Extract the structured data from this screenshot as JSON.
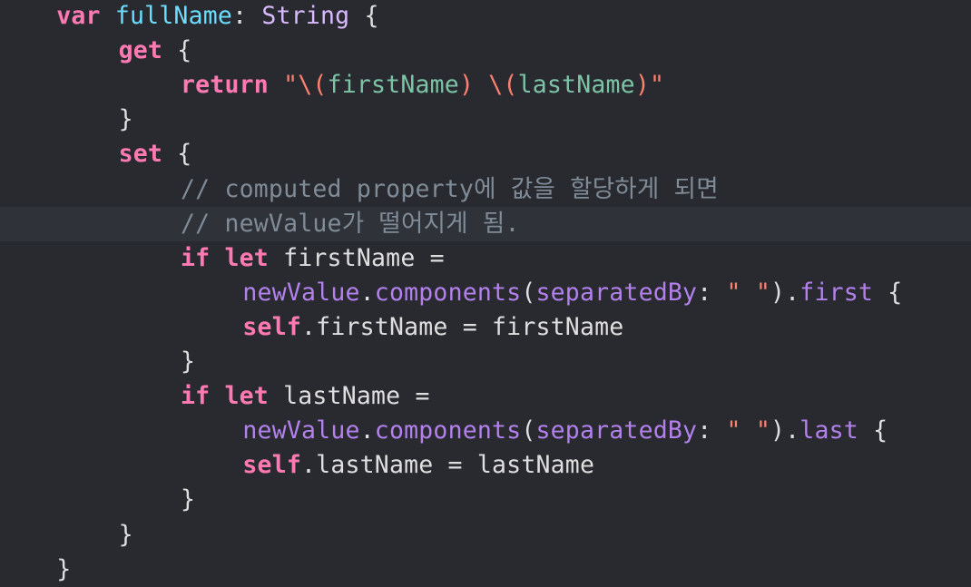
{
  "editor": {
    "current_line_index": 6,
    "lines": [
      {
        "indent": 2,
        "tokens": [
          {
            "t": "var",
            "c": "kw"
          },
          {
            "t": " ",
            "c": "plain"
          },
          {
            "t": "fullName",
            "c": "decl"
          },
          {
            "t": ": ",
            "c": "plain"
          },
          {
            "t": "String",
            "c": "type"
          },
          {
            "t": " {",
            "c": "plain"
          }
        ]
      },
      {
        "indent": 6,
        "tokens": [
          {
            "t": "get",
            "c": "kw"
          },
          {
            "t": " {",
            "c": "plain"
          }
        ]
      },
      {
        "indent": 10,
        "tokens": [
          {
            "t": "return",
            "c": "kw"
          },
          {
            "t": " ",
            "c": "plain"
          },
          {
            "t": "\"\\(",
            "c": "str"
          },
          {
            "t": "firstName",
            "c": "prop"
          },
          {
            "t": ") \\(",
            "c": "str"
          },
          {
            "t": "lastName",
            "c": "prop"
          },
          {
            "t": ")\"",
            "c": "str"
          }
        ]
      },
      {
        "indent": 6,
        "tokens": [
          {
            "t": "}",
            "c": "plain"
          }
        ]
      },
      {
        "indent": 6,
        "tokens": [
          {
            "t": "set",
            "c": "kw"
          },
          {
            "t": " {",
            "c": "plain"
          }
        ]
      },
      {
        "indent": 10,
        "tokens": [
          {
            "t": "// computed property에 값을 할당하게 되면",
            "c": "cmt"
          }
        ]
      },
      {
        "indent": 10,
        "tokens": [
          {
            "t": "// newValue가 떨어지게 됨.",
            "c": "cmt"
          }
        ]
      },
      {
        "indent": 10,
        "tokens": [
          {
            "t": "if",
            "c": "kw"
          },
          {
            "t": " ",
            "c": "plain"
          },
          {
            "t": "let",
            "c": "kw"
          },
          {
            "t": " firstName =",
            "c": "plain"
          }
        ]
      },
      {
        "indent": 14,
        "tokens": [
          {
            "t": "newValue",
            "c": "meth"
          },
          {
            "t": ".",
            "c": "plain"
          },
          {
            "t": "components",
            "c": "meth"
          },
          {
            "t": "(",
            "c": "plain"
          },
          {
            "t": "separatedBy",
            "c": "meth"
          },
          {
            "t": ": ",
            "c": "plain"
          },
          {
            "t": "\" \"",
            "c": "str"
          },
          {
            "t": ").",
            "c": "plain"
          },
          {
            "t": "first",
            "c": "meth"
          },
          {
            "t": " {",
            "c": "plain"
          }
        ]
      },
      {
        "indent": 14,
        "tokens": [
          {
            "t": "self",
            "c": "kw"
          },
          {
            "t": ".firstName = firstName",
            "c": "plain"
          }
        ]
      },
      {
        "indent": 10,
        "tokens": [
          {
            "t": "}",
            "c": "plain"
          }
        ]
      },
      {
        "indent": 10,
        "tokens": [
          {
            "t": "if",
            "c": "kw"
          },
          {
            "t": " ",
            "c": "plain"
          },
          {
            "t": "let",
            "c": "kw"
          },
          {
            "t": " lastName =",
            "c": "plain"
          }
        ]
      },
      {
        "indent": 14,
        "tokens": [
          {
            "t": "newValue",
            "c": "meth"
          },
          {
            "t": ".",
            "c": "plain"
          },
          {
            "t": "components",
            "c": "meth"
          },
          {
            "t": "(",
            "c": "plain"
          },
          {
            "t": "separatedBy",
            "c": "meth"
          },
          {
            "t": ": ",
            "c": "plain"
          },
          {
            "t": "\" \"",
            "c": "str"
          },
          {
            "t": ").",
            "c": "plain"
          },
          {
            "t": "last",
            "c": "meth"
          },
          {
            "t": " {",
            "c": "plain"
          }
        ]
      },
      {
        "indent": 14,
        "tokens": [
          {
            "t": "self",
            "c": "kw"
          },
          {
            "t": ".lastName = lastName",
            "c": "plain"
          }
        ]
      },
      {
        "indent": 10,
        "tokens": [
          {
            "t": "}",
            "c": "plain"
          }
        ]
      },
      {
        "indent": 6,
        "tokens": [
          {
            "t": "}",
            "c": "plain"
          }
        ]
      },
      {
        "indent": 2,
        "tokens": [
          {
            "t": "}",
            "c": "plain"
          }
        ]
      }
    ]
  },
  "colors": {
    "background": "#292a30",
    "current_line": "#2f3239",
    "keyword": "#ff7ab2",
    "declaration": "#6bdfff",
    "type": "#dabaff",
    "property": "#7dc4a6",
    "method": "#b281eb",
    "string": "#ff8170",
    "comment": "#7f8c98",
    "plain": "#dfdfe0"
  }
}
